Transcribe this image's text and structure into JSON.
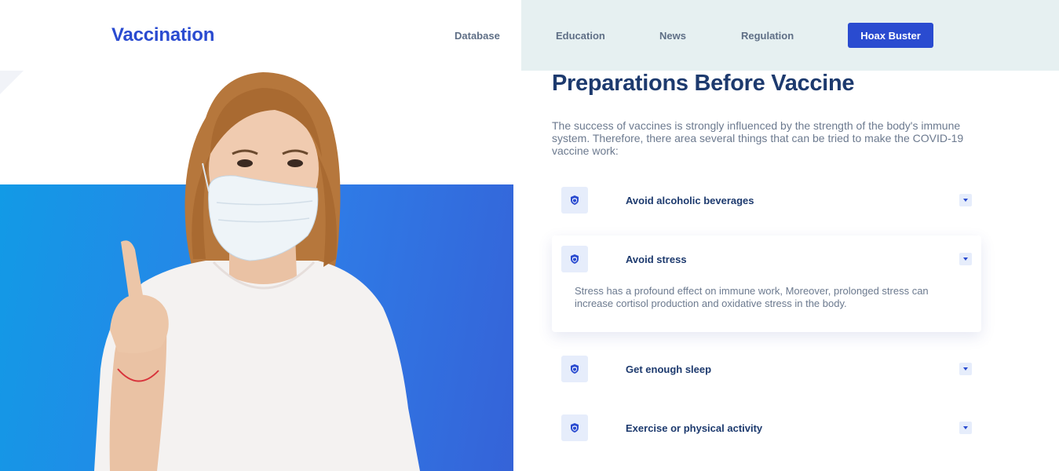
{
  "header": {
    "logo": "Vaccination",
    "nav": [
      "Database",
      "Education",
      "News",
      "Regulation"
    ],
    "cta": "Hoax Buster"
  },
  "hero": {
    "image": "woman-wearing-face-mask-raising-finger"
  },
  "content": {
    "title": "Preparations Before Vaccine",
    "intro": "The success of vaccines is strongly influenced by the strength of the body's immune system. Therefore, there area several things that can be tried to make the COVID-19 vaccine work:",
    "items": [
      {
        "label": "Avoid alcoholic beverages",
        "expanded": false
      },
      {
        "label": "Avoid stress",
        "expanded": true,
        "body": "Stress has a profound effect on immune work, Moreover, prolonged stress can increase cortisol production and oxidative stress in the body."
      },
      {
        "label": "Get enough sleep",
        "expanded": false
      },
      {
        "label": "Exercise or physical activity",
        "expanded": false
      }
    ]
  },
  "icons": {
    "item_icon": "shield-icon",
    "toggle_icon": "chevron-down-icon"
  },
  "colors": {
    "brand": "#2a4bd0",
    "heading": "#1d3a6e",
    "body_text": "#6c7a8f",
    "nav_bg": "#e6f0f1",
    "icon_bg": "#e6edfb",
    "hero_gradient_start": "#129ae6",
    "hero_gradient_end": "#3563d8"
  }
}
